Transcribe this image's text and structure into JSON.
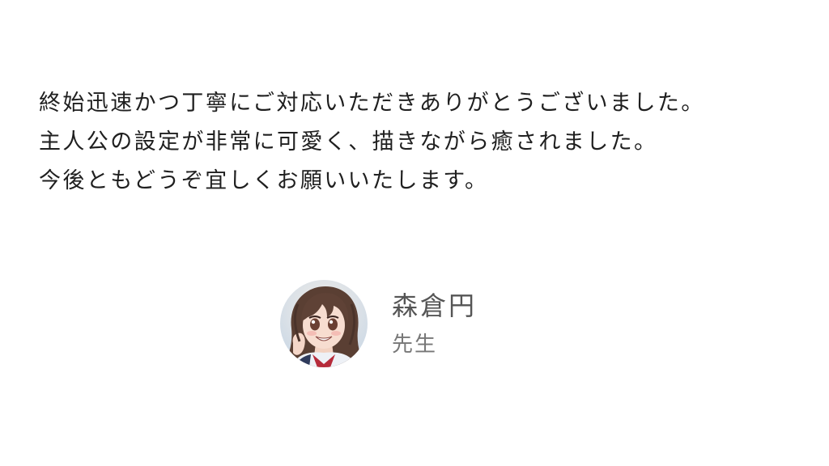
{
  "testimonial": {
    "lines": [
      "終始迅速かつ丁寧にご対応いただきありがとうございました。",
      "主人公の設定が非常に可愛く、描きながら癒されました。",
      "今後ともどうぞ宜しくお願いいたします。"
    ]
  },
  "author": {
    "name": "森倉円",
    "role": "先生",
    "avatar_icon": "anime-girl-portrait"
  },
  "colors": {
    "background": "#ffffff",
    "body_text": "#1f1f1f",
    "name_text": "#555555",
    "role_text": "#777777"
  }
}
